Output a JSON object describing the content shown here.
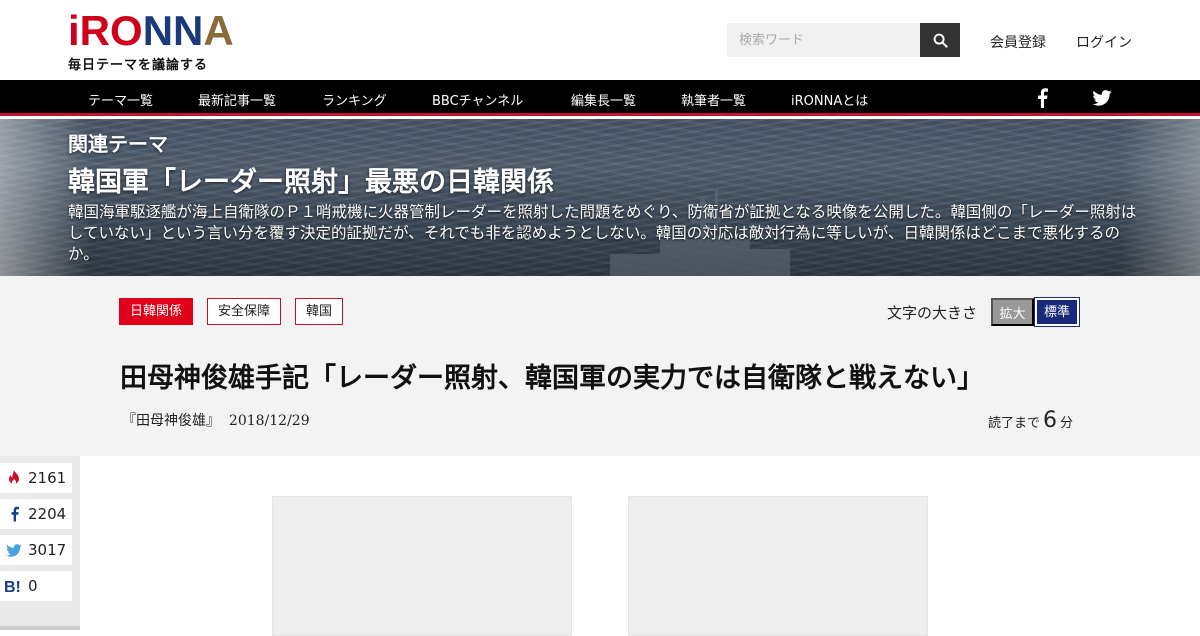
{
  "header": {
    "logo_parts": [
      "i",
      "R",
      "O",
      "N",
      "N",
      "A"
    ],
    "tagline": "毎日テーマを議論する",
    "search_placeholder": "検索ワード",
    "register": "会員登録",
    "login": "ログイン"
  },
  "nav": {
    "items": [
      "テーマ一覧",
      "最新記事一覧",
      "ランキング",
      "BBCチャンネル",
      "編集長一覧",
      "執筆者一覧",
      "iRONNAとは"
    ]
  },
  "hero": {
    "label": "関連テーマ",
    "title": "韓国軍「レーダー照射」最悪の日韓関係",
    "description": "韓国海軍駆逐艦が海上自衛隊のＰ１哨戒機に火器管制レーダーを照射した問題をめぐり、防衛省が証拠となる映像を公開した。韓国側の「レーダー照射はしていない」という言い分を覆す決定的証拠だが、それでも非を認めようとしない。韓国の対応は敵対行為に等しいが、日韓関係はどこまで悪化するのか。"
  },
  "article": {
    "tags": [
      "日韓関係",
      "安全保障",
      "韓国"
    ],
    "font_size_label": "文字の大きさ",
    "font_large": "拡大",
    "font_standard": "標準",
    "title": "田母神俊雄手記「レーダー照射、韓国軍の実力では自衛隊と戦えない」",
    "author": "『田母神俊雄』",
    "date": "2018/12/29",
    "read_prefix": "読了まで",
    "read_minutes": "6",
    "read_suffix": "分"
  },
  "share": {
    "hot_count": "2161",
    "facebook_count": "2204",
    "twitter_count": "3017",
    "hatena_count": "0"
  },
  "colors": {
    "brand_red": "#e0001a",
    "navy": "#1a2a7a",
    "nav_bg": "#000000"
  }
}
